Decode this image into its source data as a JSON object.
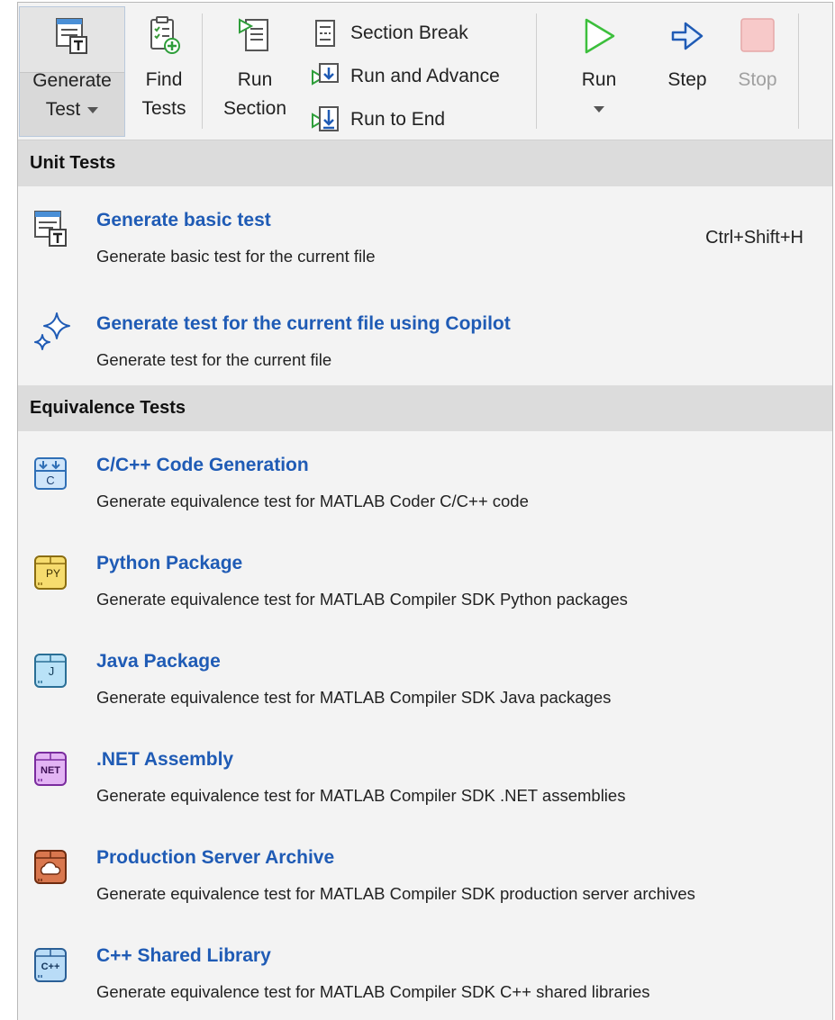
{
  "toolbar": {
    "generate_test": {
      "line1": "Generate",
      "line2": "Test"
    },
    "find_tests": {
      "line1": "Find",
      "line2": "Tests"
    },
    "run_section": {
      "line1": "Run",
      "line2": "Section"
    },
    "section_break": "Section Break",
    "run_and_advance": "Run and Advance",
    "run_to_end": "Run to End",
    "run": "Run",
    "step": "Step",
    "stop": "Stop"
  },
  "menu": {
    "unit_tests_header": "Unit Tests",
    "unit_items": [
      {
        "title": "Generate basic test",
        "desc": "Generate basic test for the current file",
        "shortcut": "Ctrl+Shift+H",
        "icon": "test-doc-icon"
      },
      {
        "title": "Generate test for the current file using Copilot",
        "desc": "Generate test for the current file",
        "icon": "copilot-sparkle-icon"
      }
    ],
    "equivalence_header": "Equivalence Tests",
    "equivalence_items": [
      {
        "title": "C/C++ Code Generation",
        "desc": "Generate equivalence test for MATLAB Coder C/C++ code",
        "icon": "c-code-icon",
        "badge": "C"
      },
      {
        "title": "Python Package",
        "desc": "Generate equivalence test for MATLAB Compiler SDK Python packages",
        "icon": "python-package-icon",
        "badge": "PY"
      },
      {
        "title": "Java Package",
        "desc": "Generate equivalence test for MATLAB Compiler SDK Java packages",
        "icon": "java-package-icon",
        "badge": "J"
      },
      {
        "title": ".NET Assembly",
        "desc": "Generate equivalence test for MATLAB Compiler SDK .NET assemblies",
        "icon": "dotnet-assembly-icon",
        "badge": "NET"
      },
      {
        "title": "Production Server Archive",
        "desc": "Generate equivalence test for MATLAB Compiler SDK production server archives",
        "icon": "production-server-icon"
      },
      {
        "title": "C++ Shared Library",
        "desc": "Generate equivalence test for MATLAB Compiler SDK C++ shared libraries",
        "icon": "cpp-shared-library-icon",
        "badge": "C++"
      }
    ]
  },
  "colors": {
    "accent_title": "#1f5bb5",
    "header_bg": "#dcdcdc",
    "menu_bg": "#f3f3f3",
    "python": "#f1d35c",
    "java": "#8cd0f2",
    "dotnet": "#c884e8",
    "server": "#c8643c",
    "run_green": "#3cbf3c",
    "stop_red": "#f7c9c9"
  }
}
